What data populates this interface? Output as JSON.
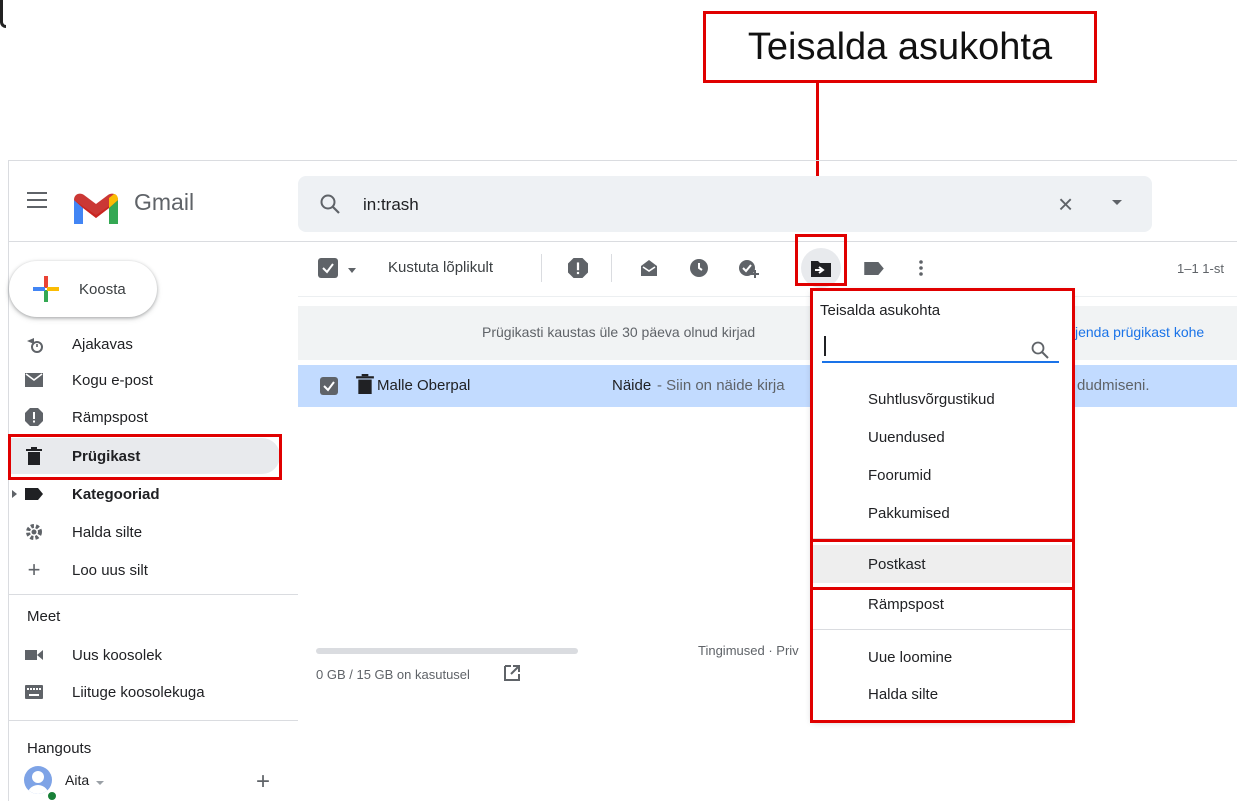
{
  "callout": {
    "text": "Teisalda asukohta"
  },
  "header": {
    "app_name": "Gmail",
    "search_value": "in:trash"
  },
  "sidebar": {
    "compose_label": "Koosta",
    "items": [
      {
        "label": "Ajakavas",
        "icon": "scheduled-icon"
      },
      {
        "label": "Kogu e-post",
        "icon": "mail-icon"
      },
      {
        "label": "Rämpspost",
        "icon": "spam-icon"
      },
      {
        "label": "Prügikast",
        "icon": "trash-icon",
        "active": true
      },
      {
        "label": "Kategooriad",
        "icon": "label-icon"
      },
      {
        "label": "Halda silte",
        "icon": "gear-icon"
      },
      {
        "label": "Loo uus silt",
        "icon": "plus-icon"
      }
    ],
    "meet_title": "Meet",
    "meet_items": [
      {
        "label": "Uus koosolek",
        "icon": "video-icon"
      },
      {
        "label": "Liituge koosolekuga",
        "icon": "keyboard-icon"
      }
    ],
    "hangouts_title": "Hangouts",
    "hangouts_user": "Aita"
  },
  "toolbar": {
    "delete_forever": "Kustuta lõplikult",
    "page_info": "1–1 1-st"
  },
  "banner": {
    "text": "Prügikasti kaustas üle 30 päeva olnud kirjad",
    "link": "jenda prügikast kohe"
  },
  "email_row": {
    "sender": "Malle Oberpal",
    "subject": "Näide",
    "snippet": " - Siin on näide kirja",
    "snippet_end": "dudmiseni."
  },
  "footer": {
    "storage": "0 GB / 15 GB on kasutusel",
    "terms": "Tingimused · Priv"
  },
  "move_menu": {
    "title": "Teisalda asukohta",
    "items_group1": [
      "Suhtlusvõrgustikud",
      "Uuendused",
      "Foorumid",
      "Pakkumised"
    ],
    "items_group2": [
      "Postkast",
      "Rämpspost"
    ],
    "items_group3": [
      "Uue loomine",
      "Halda silte"
    ]
  }
}
